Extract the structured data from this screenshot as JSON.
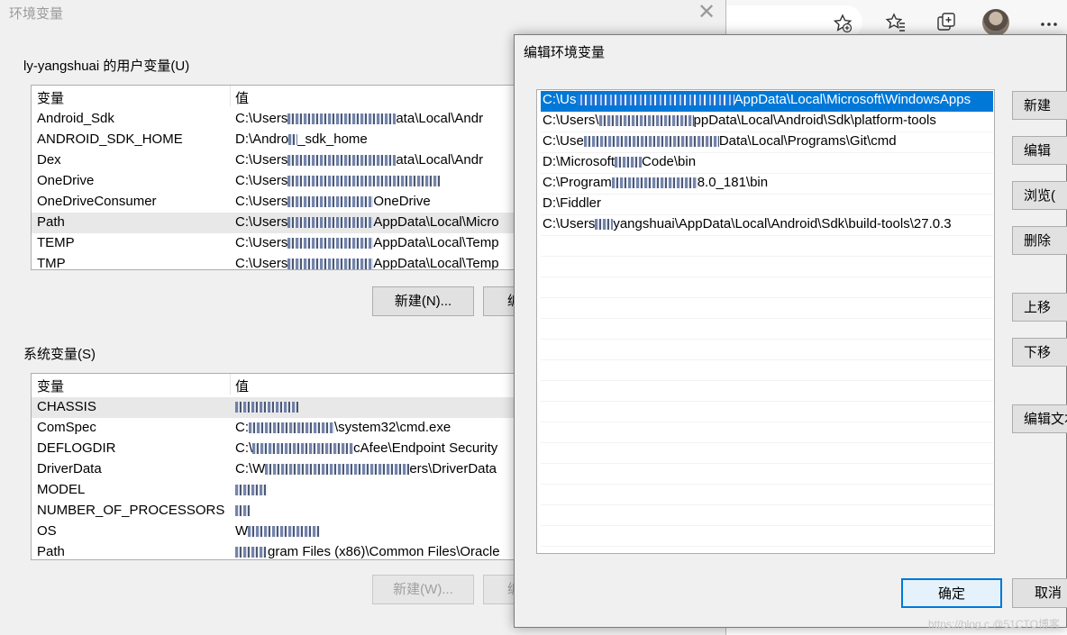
{
  "env_dialog": {
    "title": "环境变量",
    "close": "✕",
    "user_section_title": "ly-yangshuai 的用户变量(U)",
    "col_var": "变量",
    "col_val": "值",
    "user_vars": [
      {
        "name": "Android_Sdk",
        "value_a": "C:\\Users",
        "value_b": "ata\\Local\\Andr"
      },
      {
        "name": "ANDROID_SDK_HOME",
        "value_a": "D:\\Andro",
        "value_b": "_sdk_home"
      },
      {
        "name": "Dex",
        "value_a": "C:\\Users",
        "value_b": "ata\\Local\\Andr"
      },
      {
        "name": "OneDrive",
        "value_a": "C:\\Users",
        "value_b": ""
      },
      {
        "name": "OneDriveConsumer",
        "value_a": "C:\\Users",
        "value_b": "OneDrive"
      },
      {
        "name": "Path",
        "value_a": "C:\\Users",
        "value_b": "AppData\\Local\\Micro"
      },
      {
        "name": "TEMP",
        "value_a": "C:\\Users",
        "value_b": "AppData\\Local\\Temp"
      },
      {
        "name": "TMP",
        "value_a": "C:\\Users",
        "value_b": "AppData\\Local\\Temp"
      }
    ],
    "user_new_button": "新建(N)...",
    "user_edit_button_partial": "编",
    "system_section_title": "系统变量(S)",
    "system_vars": [
      {
        "name": "CHASSIS",
        "value_a": "",
        "value_b": ""
      },
      {
        "name": "ComSpec",
        "value_a": "C:",
        "value_b": "\\system32\\cmd.exe"
      },
      {
        "name": "DEFLOGDIR",
        "value_a": "C:\\",
        "value_b": "cAfee\\Endpoint Security"
      },
      {
        "name": "DriverData",
        "value_a": "C:\\W",
        "value_b": "ers\\DriverData"
      },
      {
        "name": "MODEL",
        "value_a": "",
        "value_b": ""
      },
      {
        "name": "NUMBER_OF_PROCESSORS",
        "value_a": "",
        "value_b": ""
      },
      {
        "name": "OS",
        "value_a": "W",
        "value_b": ""
      },
      {
        "name": "Path",
        "value_a": "",
        "value_b": "gram Files (x86)\\Common Files\\Oracle"
      }
    ],
    "system_new_button": "新建(W)...",
    "system_edit_button_partial": "编"
  },
  "edit_dialog": {
    "title": "编辑环境变量",
    "paths": [
      {
        "a": "C:\\Us",
        "b": "AppData\\Local\\Microsoft\\WindowsApps"
      },
      {
        "a": "C:\\Users\\",
        "b": "ppData\\Local\\Android\\Sdk\\platform-tools"
      },
      {
        "a": "C:\\Use",
        "b": "Data\\Local\\Programs\\Git\\cmd"
      },
      {
        "a": "D:\\Microsoft",
        "b": "Code\\bin"
      },
      {
        "a": "C:\\Program",
        "b": "8.0_181\\bin"
      },
      {
        "a": "D:\\Fiddler",
        "b": ""
      },
      {
        "a": "C:\\Users",
        "b": "yangshuai\\AppData\\Local\\Android\\Sdk\\build-tools\\27.0.3"
      }
    ],
    "buttons": {
      "new": "新建",
      "edit": "编辑",
      "browse": "浏览(",
      "delete": "删除",
      "move_up": "上移",
      "move_down": "下移",
      "edit_text": "编辑文本"
    },
    "ok": "确定",
    "cancel": "取消"
  },
  "watermark": "https://blog.c @51CTO博客"
}
